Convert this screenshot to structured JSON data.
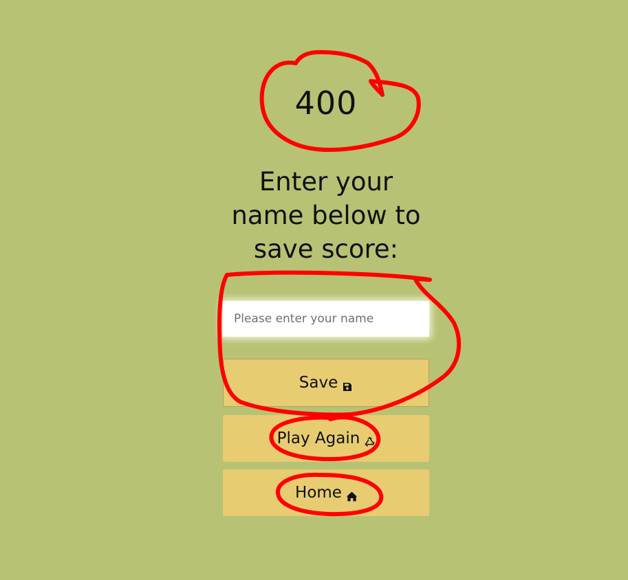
{
  "score": "400",
  "prompt": "Enter your name below to save score:",
  "name_input": {
    "placeholder": "Please enter your name",
    "value": ""
  },
  "buttons": {
    "save": {
      "label": "Save",
      "icon": "floppy-disk-icon"
    },
    "play_again": {
      "label": "Play Again",
      "icon": "recycle-icon"
    },
    "home": {
      "label": "Home",
      "icon": "home-icon"
    }
  },
  "colors": {
    "background": "#b7c274",
    "button": "#e7cc72",
    "annotation": "#ff0000",
    "input_background": "#ffffff"
  }
}
